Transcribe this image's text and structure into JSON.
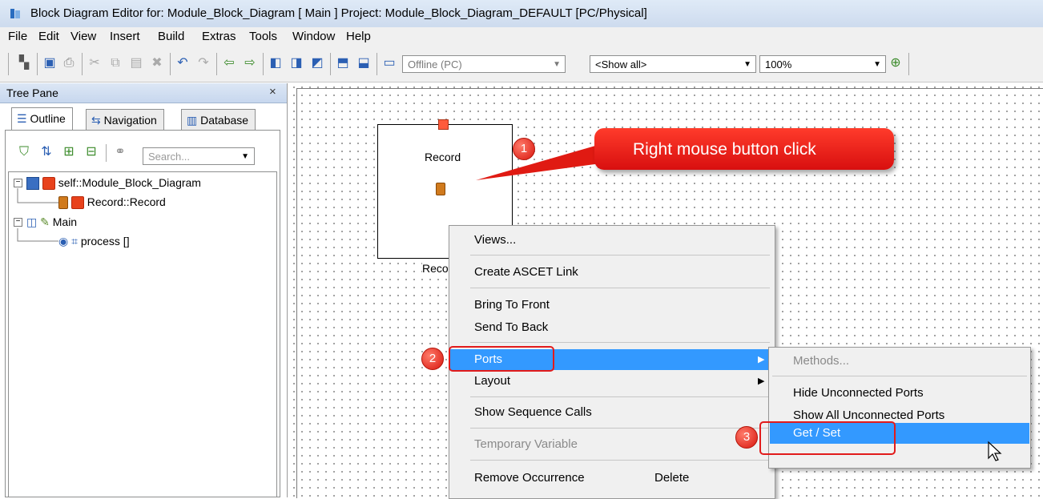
{
  "window": {
    "title": "Block Diagram Editor for: Module_Block_Diagram [ Main ] Project: Module_Block_Diagram_DEFAULT [PC/Physical]"
  },
  "menubar": {
    "items": [
      "File",
      "Edit",
      "View",
      "Insert",
      "Build",
      "Extras",
      "Tools",
      "Window",
      "Help"
    ]
  },
  "toolbar": {
    "mode_combo": "Offline (PC)",
    "show_combo": "<Show all>",
    "zoom_combo": "100%"
  },
  "tree_pane": {
    "title": "Tree Pane",
    "close": "×",
    "tabs": [
      "Outline",
      "Navigation",
      "Database"
    ],
    "search_placeholder": "Search...",
    "rows": [
      "self::Module_Block_Diagram",
      "Record::Record",
      "Main",
      "process []"
    ]
  },
  "canvas": {
    "block_label": "Record",
    "block_below_label": "Reco",
    "callout": "Right mouse button click",
    "badges": [
      "1",
      "2",
      "3"
    ]
  },
  "context_menu": {
    "items": [
      "Views...",
      "Create ASCET Link",
      "Bring To Front",
      "Send To Back",
      "Ports",
      "Layout",
      "Show Sequence Calls",
      "Temporary Variable",
      "Remove Occurrence"
    ],
    "remove_shortcut": "Delete"
  },
  "submenu": {
    "items": [
      "Methods...",
      "Hide Unconnected Ports",
      "Show All Unconnected Ports",
      "Get / Set"
    ]
  },
  "colors": {
    "highlight": "#3399ff",
    "annotation_red": "#e21b1b"
  }
}
